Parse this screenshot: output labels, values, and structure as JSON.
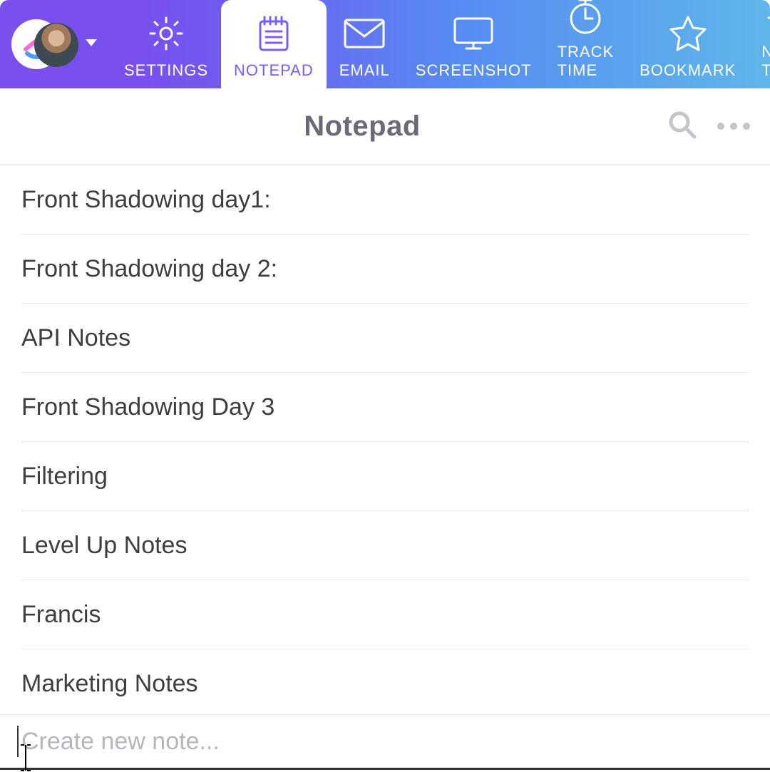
{
  "header": {
    "tabs": [
      {
        "name": "settings",
        "label": "SETTINGS"
      },
      {
        "name": "notepad",
        "label": "NOTEPAD"
      },
      {
        "name": "email",
        "label": "EMAIL"
      },
      {
        "name": "screenshot",
        "label": "SCREENSHOT"
      },
      {
        "name": "tracktime",
        "label": "TRACK TIME"
      },
      {
        "name": "bookmark",
        "label": "BOOKMARK"
      },
      {
        "name": "newtask",
        "label": "NEW TASK"
      }
    ],
    "active_tab": "notepad"
  },
  "page": {
    "title": "Notepad",
    "search_icon": "search",
    "more_icon": "more"
  },
  "notes": [
    {
      "title": "Front Shadowing day1:"
    },
    {
      "title": "Front Shadowing day 2:"
    },
    {
      "title": "API Notes"
    },
    {
      "title": "Front Shadowing Day 3"
    },
    {
      "title": "Filtering"
    },
    {
      "title": "Level Up Notes"
    },
    {
      "title": "Francis"
    },
    {
      "title": "Marketing Notes"
    }
  ],
  "footer": {
    "placeholder": "Create new note..."
  }
}
